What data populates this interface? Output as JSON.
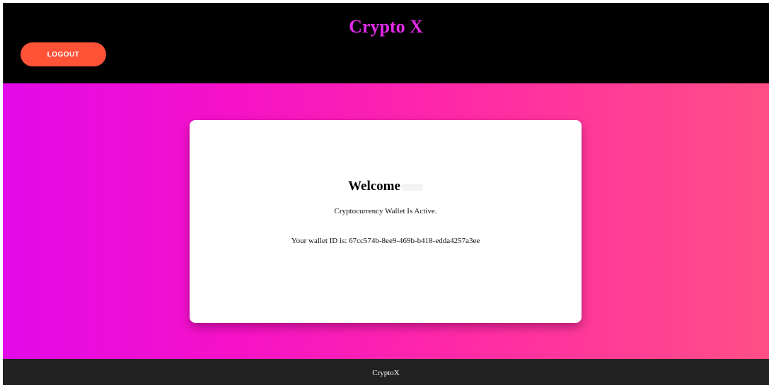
{
  "header": {
    "title": "Crypto X",
    "logout_label": "LOGOUT"
  },
  "card": {
    "welcome": "Welcome",
    "status": "Cryptocurrency Wallet Is Active.",
    "wallet_label": "Your wallet ID is: 67cc574b-8ee9-469b-b418-edda4257a3ee"
  },
  "footer": {
    "text": "CryptoX"
  },
  "colors": {
    "header_bg": "#000000",
    "title": "#e22ae8",
    "logout_bg": "#ff5236",
    "gradient_start": "#e20ae8",
    "gradient_end": "#ff4f86",
    "footer_bg": "#222222"
  }
}
